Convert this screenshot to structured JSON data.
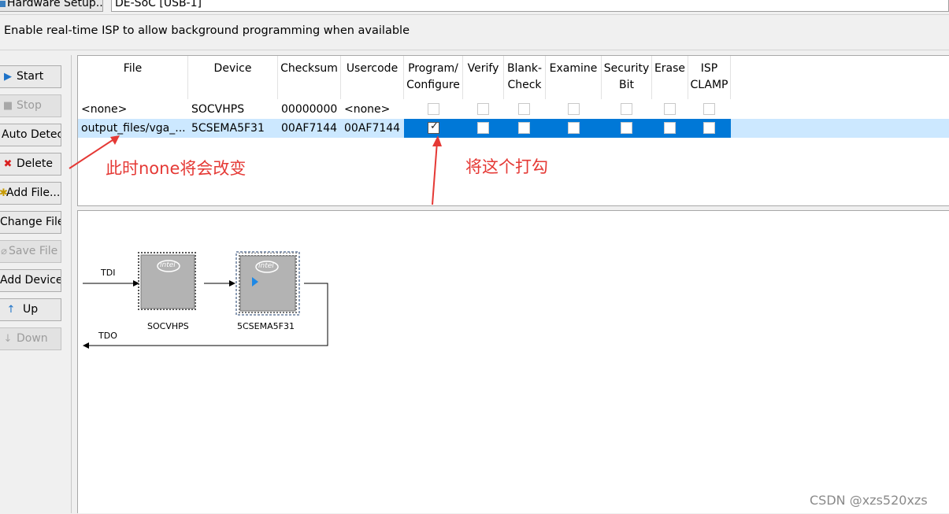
{
  "topbar": {
    "hardware_setup_label": "Hardware Setup...",
    "hardware_value": "DE-SoC [USB-1]"
  },
  "isp_text": "Enable real-time ISP to allow background programming when available",
  "buttons": [
    {
      "label": "Start",
      "icon": "play-icon",
      "enabled": true
    },
    {
      "label": "Stop",
      "icon": "stop-icon",
      "enabled": false
    },
    {
      "label": "Auto Detec",
      "icon": "",
      "enabled": true
    },
    {
      "label": "Delete",
      "icon": "delete-x-icon",
      "enabled": true
    },
    {
      "label": "Add File...",
      "icon": "add-file-icon",
      "enabled": true
    },
    {
      "label": "Change File",
      "icon": "",
      "enabled": true
    },
    {
      "label": "Save File",
      "icon": "save-icon",
      "enabled": false
    },
    {
      "label": "Add Device",
      "icon": "",
      "enabled": true
    },
    {
      "label": "Up",
      "icon": "up-arrow-icon",
      "enabled": true
    },
    {
      "label": "Down",
      "icon": "down-arrow-icon",
      "enabled": false
    }
  ],
  "table": {
    "headers": {
      "file": "File",
      "device": "Device",
      "checksum": "Checksum",
      "usercode": "Usercode",
      "program_l1": "Program/",
      "program_l2": "Configure",
      "verify": "Verify",
      "blank_l1": "Blank-",
      "blank_l2": "Check",
      "examine": "Examine",
      "security_l1": "Security",
      "security_l2": "Bit",
      "erase": "Erase",
      "isp_l1": "ISP",
      "isp_l2": "CLAMP"
    },
    "rows": [
      {
        "file": "<none>",
        "device": "SOCVHPS",
        "checksum": "00000000",
        "usercode": "<none>",
        "program": false,
        "selected": false
      },
      {
        "file": "output_files/vga_...",
        "device": "5CSEMA5F31",
        "checksum": "00AF7144",
        "usercode": "00AF7144",
        "program": true,
        "selected": true
      }
    ]
  },
  "chain": {
    "tdi": "TDI",
    "tdo": "TDO",
    "chips": [
      {
        "name": "SOCVHPS",
        "logo": "intel"
      },
      {
        "name": "5CSEMA5F31",
        "logo": "intel"
      }
    ]
  },
  "annotations": {
    "left": "此时none将会改变",
    "right": "将这个打勾",
    "color": "#e53935"
  },
  "watermark": "CSDN @xzs520xzs",
  "colors": {
    "selection": "#0078d7",
    "row_highlight": "#cce8ff"
  }
}
